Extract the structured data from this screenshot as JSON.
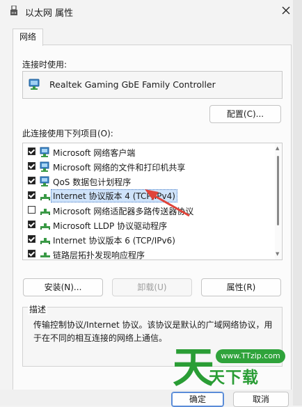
{
  "window": {
    "title": "以太网 属性",
    "close_icon": "close-icon"
  },
  "tabs": [
    {
      "label": "网络",
      "active": true
    }
  ],
  "connect_using_label": "连接时使用:",
  "adapter": {
    "name": "Realtek Gaming GbE Family Controller",
    "icon": "network-adapter-icon"
  },
  "configure_button": "配置(C)...",
  "items_label": "此连接使用下列项目(O):",
  "items": [
    {
      "label": "Microsoft 网络客户端",
      "checked": true,
      "icon": "network-client-icon"
    },
    {
      "label": "Microsoft 网络的文件和打印机共享",
      "checked": true,
      "icon": "network-share-icon"
    },
    {
      "label": "QoS 数据包计划程序",
      "checked": true,
      "icon": "network-client-icon"
    },
    {
      "label": "Internet 协议版本 4 (TCP/IPv4)",
      "checked": true,
      "selected": true,
      "icon": "protocol-icon"
    },
    {
      "label": "Microsoft 网络适配器多路传送器协议",
      "checked": false,
      "icon": "protocol-icon"
    },
    {
      "label": "Microsoft LLDP 协议驱动程序",
      "checked": true,
      "icon": "protocol-icon"
    },
    {
      "label": "Internet 协议版本 6 (TCP/IPv6)",
      "checked": true,
      "icon": "protocol-icon"
    },
    {
      "label": "链路层拓扑发现响应程序",
      "checked": true,
      "icon": "protocol-icon"
    }
  ],
  "buttons": {
    "install": "安装(N)...",
    "uninstall": "卸载(U)",
    "properties": "属性(R)",
    "ok": "确定",
    "cancel": "取消"
  },
  "description": {
    "title": "描述",
    "text": "传输控制协议/Internet 协议。该协议是默认的广域网络协议，用于在不同的相互连接的网络上通信。"
  },
  "watermark": {
    "url": "www.TTzip.com",
    "name": "天下载",
    "logo": "tian-logo-icon"
  },
  "colors": {
    "accent": "#5a8cd8",
    "selection": "#cfe3fa",
    "watermark_green": "#2fa33b",
    "arrow_red": "#e0443a"
  }
}
